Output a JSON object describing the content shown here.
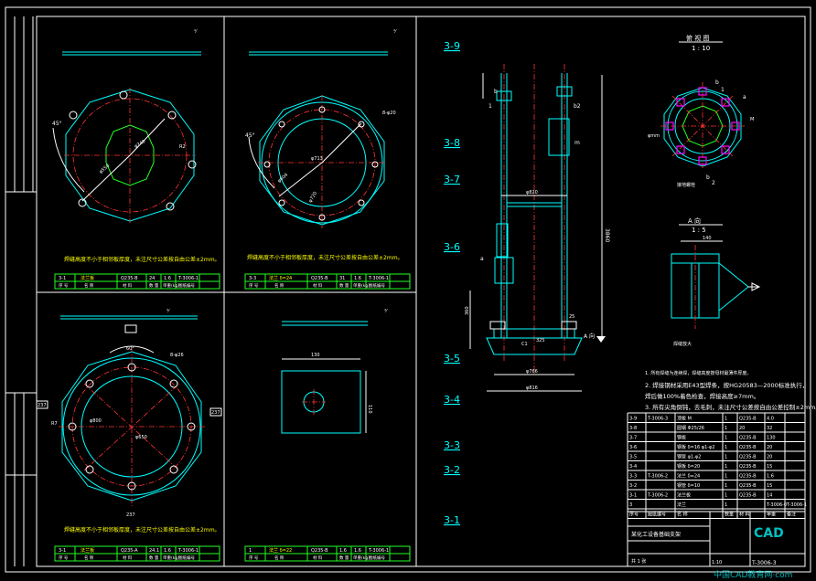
{
  "section_labels": [
    "3-9",
    "3-8",
    "3-7",
    "3-6",
    "3-5",
    "3-4",
    "3-3",
    "3-2",
    "3-1"
  ],
  "views": {
    "top_view_title": "俯 视 图",
    "top_view_scale": "1 : 10",
    "section_title": "A  向",
    "section_scale": "1 : 5",
    "section_dim": "140",
    "arrow_label": "A  向"
  },
  "part_tables": [
    {
      "no": "3-1",
      "code": "法兰板",
      "material": "Q235-B",
      "qty": "24",
      "unit": "1.6",
      "std": "T-3006-1"
    },
    {
      "no": "3-3",
      "code": "法兰 δ=24",
      "material": "Q235-B",
      "qty": "31",
      "unit": "1.6",
      "std": "T-3006-1"
    },
    {
      "no": "3-1",
      "code": "法兰板",
      "material": "Q235-A",
      "qty": "24.1",
      "unit": "1.6",
      "std": "T-3006-1"
    },
    {
      "no": "1",
      "code": "法兰 δ=22",
      "material": "Q235-B",
      "qty": "1.6",
      "unit": "1.6",
      "std": "T-3006-1"
    }
  ],
  "table_headers": [
    "序 号",
    "名  称",
    "材 料",
    "数 量",
    "单重(kg)",
    "图纸编号",
    "备注"
  ],
  "notes": [
    "1. 所有焊缝为连续焊，焊缝高度按母材最薄件厚度。",
    "2. 焊接钢材采用E43型焊条，按HG20583—2000标准执行，",
    "   焊后做100%着色检查，焊接高度≥7mm。",
    "3. 所有尖角倒钝，去毛刺，未注尺寸公差按自由公差控制±2mm。"
  ],
  "view_notes": [
    "焊缝高度不小于相邻板厚度，未注尺寸公差按自由公差±2mm。",
    "焊缝高度不小于相邻板厚度，未注尺寸公差按自由公差±2mm。",
    "焊缝高度不小于相邻板厚度，未注尺寸公差按自由公差±2mm。"
  ],
  "bom": {
    "rows": [
      [
        "3-9",
        "T-3006-3",
        "顶板 M",
        "1",
        "Q235-B",
        "4.0",
        ""
      ],
      [
        "3-8",
        "",
        "圆钢 Φ25/26",
        "1",
        "20",
        "32",
        ""
      ],
      [
        "3-7",
        "",
        "钢板",
        "1",
        "Q235-B",
        "130",
        ""
      ],
      [
        "3-6",
        "",
        "钢板 δ=16 φ1-φ2",
        "1",
        "Q235-B",
        "20",
        ""
      ],
      [
        "3-5",
        "",
        "钢管 φ1-φ2",
        "1",
        "Q235-B",
        "20",
        ""
      ],
      [
        "3-4",
        "",
        "钢板 δ=20",
        "1",
        "Q235-B",
        "15",
        ""
      ],
      [
        "3-3",
        "T-3006-2",
        "法兰 δ=24",
        "1",
        "Q235-B",
        "1.6",
        ""
      ],
      [
        "3-2",
        "",
        "钢管 δ=10",
        "1",
        "Q235-B",
        "15",
        ""
      ],
      [
        "3-1",
        "T-3006-2",
        "法兰板",
        "1",
        "Q235-B",
        "14",
        ""
      ]
    ],
    "headers": [
      "序号",
      "图纸编号",
      "名 称",
      "数量",
      "材 料",
      "单重",
      "备注"
    ],
    "bottom_row": [
      "3",
      "",
      "法兰",
      "1",
      "",
      "T-3006-0",
      "T-3006-1"
    ]
  },
  "title_block": {
    "title": "某化工设备基础支架",
    "drawing_no": "T-3006-3",
    "scale": "1:10",
    "sheet": "共 1 张"
  },
  "watermark": {
    "brand": "CAD",
    "site": "中国CAD教育网·com"
  }
}
